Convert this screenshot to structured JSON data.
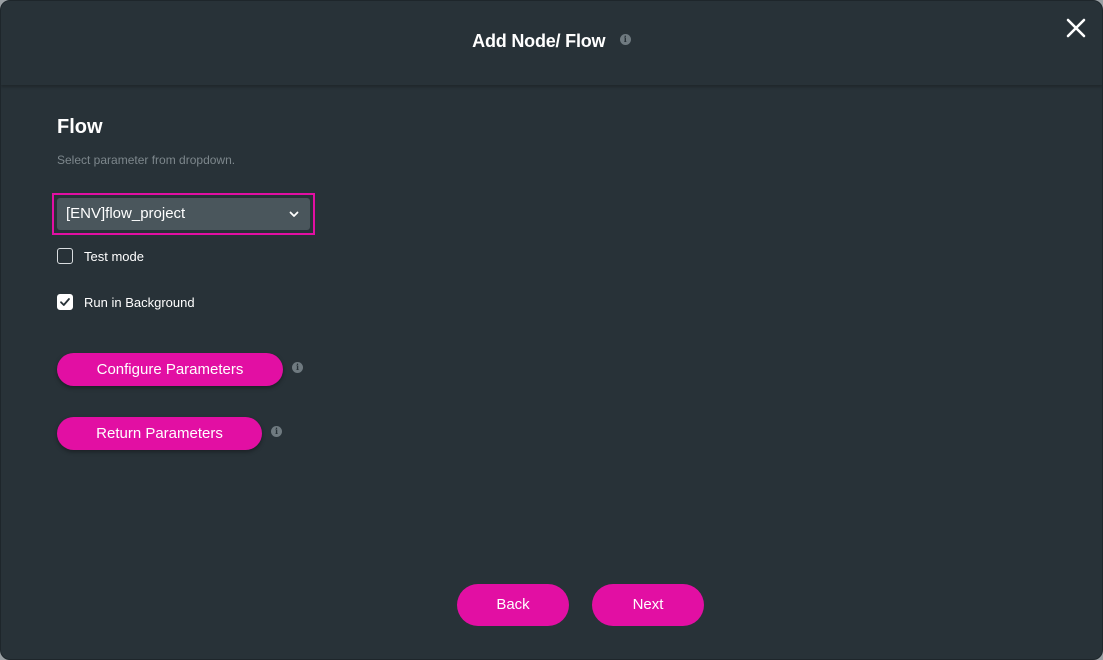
{
  "dialog": {
    "title": "Add Node/ Flow",
    "title_info_icon": "info-icon",
    "close_icon": "close-icon"
  },
  "flow_section": {
    "heading": "Flow",
    "subtitle": "Select parameter from dropdown.",
    "dropdown": {
      "selected_value": "[ENV]flow_project",
      "icon": "chevron-down-icon"
    },
    "options": [
      {
        "label": "Test mode",
        "checked": false
      },
      {
        "label": "Run in Background",
        "checked": true
      }
    ],
    "buttons": {
      "configure_parameters": "Configure Parameters",
      "return_parameters": "Return Parameters"
    }
  },
  "footer": {
    "back_label": "Back",
    "next_label": "Next"
  },
  "colors": {
    "background": "#283238",
    "accent": "#e20fa3",
    "dropdown_bg": "#4a565c",
    "muted_text": "#7d878c"
  }
}
